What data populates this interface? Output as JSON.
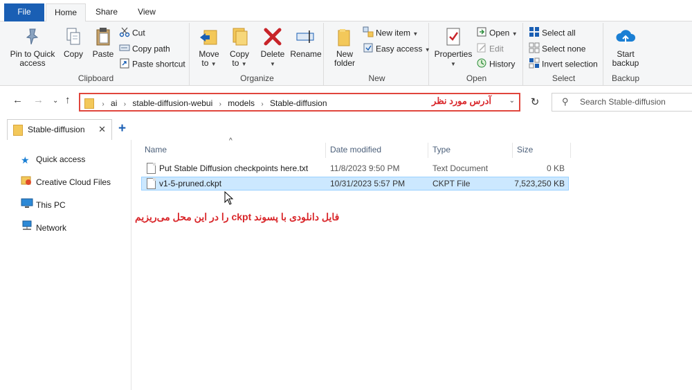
{
  "ribbon_tabs": [
    "File",
    "Home",
    "Share",
    "View"
  ],
  "clipboard": {
    "pin_label_1": "Pin to Quick",
    "pin_label_2": "access",
    "copy": "Copy",
    "paste": "Paste",
    "cut": "Cut",
    "copy_path": "Copy path",
    "paste_shortcut": "Paste shortcut",
    "group": "Clipboard"
  },
  "organize": {
    "move_1": "Move",
    "move_2": "to",
    "copy_1": "Copy",
    "copy_2": "to",
    "delete": "Delete",
    "rename": "Rename",
    "group": "Organize"
  },
  "new": {
    "folder_1": "New",
    "folder_2": "folder",
    "new_item": "New item",
    "easy_access": "Easy access",
    "group": "New"
  },
  "open": {
    "properties": "Properties",
    "open": "Open",
    "edit": "Edit",
    "history": "History",
    "group": "Open"
  },
  "select": {
    "select_all": "Select all",
    "select_none": "Select none",
    "invert": "Invert selection",
    "group": "Select"
  },
  "backup": {
    "start_1": "Start",
    "start_2": "backup",
    "group": "Backup"
  },
  "address": {
    "crumbs": [
      "ai",
      "stable-diffusion-webui",
      "models",
      "Stable-diffusion"
    ],
    "annotation": "آدرس مورد نظر"
  },
  "search": {
    "placeholder": "Search Stable-diffusion"
  },
  "explorer_tab": {
    "label": "Stable-diffusion"
  },
  "nav": {
    "quick_access": "Quick access",
    "creative_cloud": "Creative Cloud Files",
    "this_pc": "This PC",
    "network": "Network"
  },
  "columns": {
    "name": "Name",
    "date": "Date modified",
    "type": "Type",
    "size": "Size"
  },
  "files": [
    {
      "name": "Put Stable Diffusion checkpoints here.txt",
      "date": "11/8/2023 9:50 PM",
      "type": "Text Document",
      "size": "0 KB"
    },
    {
      "name": "v1-5-pruned.ckpt",
      "date": "10/31/2023 5:57 PM",
      "type": "CKPT File",
      "size": "7,523,250 KB"
    }
  ],
  "annotation_bottom": "فایل دانلودی با پسوند ckpt را در این محل می‌ریزیم",
  "colors": {
    "accent": "#1a5fb4",
    "annotation": "#d9262a",
    "selection": "#cce8ff"
  }
}
